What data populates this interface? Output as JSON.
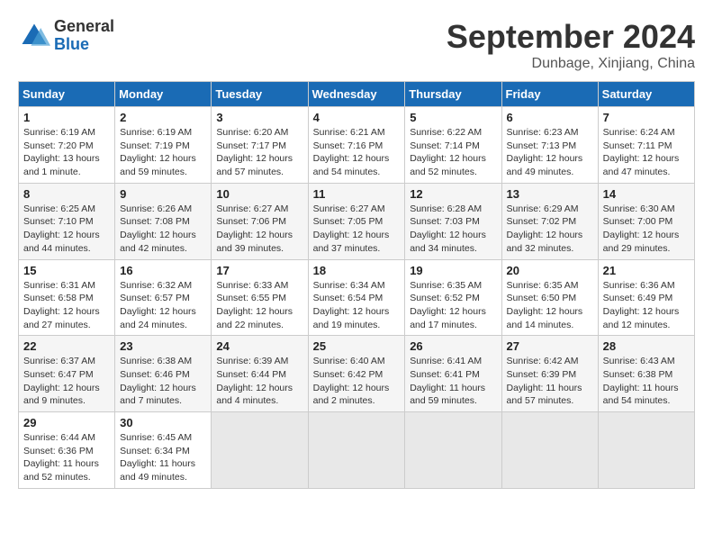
{
  "header": {
    "logo_general": "General",
    "logo_blue": "Blue",
    "month_title": "September 2024",
    "location": "Dunbage, Xinjiang, China"
  },
  "weekdays": [
    "Sunday",
    "Monday",
    "Tuesday",
    "Wednesday",
    "Thursday",
    "Friday",
    "Saturday"
  ],
  "weeks": [
    [
      {
        "day": "1",
        "info": "Sunrise: 6:19 AM\nSunset: 7:20 PM\nDaylight: 13 hours\nand 1 minute."
      },
      {
        "day": "2",
        "info": "Sunrise: 6:19 AM\nSunset: 7:19 PM\nDaylight: 12 hours\nand 59 minutes."
      },
      {
        "day": "3",
        "info": "Sunrise: 6:20 AM\nSunset: 7:17 PM\nDaylight: 12 hours\nand 57 minutes."
      },
      {
        "day": "4",
        "info": "Sunrise: 6:21 AM\nSunset: 7:16 PM\nDaylight: 12 hours\nand 54 minutes."
      },
      {
        "day": "5",
        "info": "Sunrise: 6:22 AM\nSunset: 7:14 PM\nDaylight: 12 hours\nand 52 minutes."
      },
      {
        "day": "6",
        "info": "Sunrise: 6:23 AM\nSunset: 7:13 PM\nDaylight: 12 hours\nand 49 minutes."
      },
      {
        "day": "7",
        "info": "Sunrise: 6:24 AM\nSunset: 7:11 PM\nDaylight: 12 hours\nand 47 minutes."
      }
    ],
    [
      {
        "day": "8",
        "info": "Sunrise: 6:25 AM\nSunset: 7:10 PM\nDaylight: 12 hours\nand 44 minutes."
      },
      {
        "day": "9",
        "info": "Sunrise: 6:26 AM\nSunset: 7:08 PM\nDaylight: 12 hours\nand 42 minutes."
      },
      {
        "day": "10",
        "info": "Sunrise: 6:27 AM\nSunset: 7:06 PM\nDaylight: 12 hours\nand 39 minutes."
      },
      {
        "day": "11",
        "info": "Sunrise: 6:27 AM\nSunset: 7:05 PM\nDaylight: 12 hours\nand 37 minutes."
      },
      {
        "day": "12",
        "info": "Sunrise: 6:28 AM\nSunset: 7:03 PM\nDaylight: 12 hours\nand 34 minutes."
      },
      {
        "day": "13",
        "info": "Sunrise: 6:29 AM\nSunset: 7:02 PM\nDaylight: 12 hours\nand 32 minutes."
      },
      {
        "day": "14",
        "info": "Sunrise: 6:30 AM\nSunset: 7:00 PM\nDaylight: 12 hours\nand 29 minutes."
      }
    ],
    [
      {
        "day": "15",
        "info": "Sunrise: 6:31 AM\nSunset: 6:58 PM\nDaylight: 12 hours\nand 27 minutes."
      },
      {
        "day": "16",
        "info": "Sunrise: 6:32 AM\nSunset: 6:57 PM\nDaylight: 12 hours\nand 24 minutes."
      },
      {
        "day": "17",
        "info": "Sunrise: 6:33 AM\nSunset: 6:55 PM\nDaylight: 12 hours\nand 22 minutes."
      },
      {
        "day": "18",
        "info": "Sunrise: 6:34 AM\nSunset: 6:54 PM\nDaylight: 12 hours\nand 19 minutes."
      },
      {
        "day": "19",
        "info": "Sunrise: 6:35 AM\nSunset: 6:52 PM\nDaylight: 12 hours\nand 17 minutes."
      },
      {
        "day": "20",
        "info": "Sunrise: 6:35 AM\nSunset: 6:50 PM\nDaylight: 12 hours\nand 14 minutes."
      },
      {
        "day": "21",
        "info": "Sunrise: 6:36 AM\nSunset: 6:49 PM\nDaylight: 12 hours\nand 12 minutes."
      }
    ],
    [
      {
        "day": "22",
        "info": "Sunrise: 6:37 AM\nSunset: 6:47 PM\nDaylight: 12 hours\nand 9 minutes."
      },
      {
        "day": "23",
        "info": "Sunrise: 6:38 AM\nSunset: 6:46 PM\nDaylight: 12 hours\nand 7 minutes."
      },
      {
        "day": "24",
        "info": "Sunrise: 6:39 AM\nSunset: 6:44 PM\nDaylight: 12 hours\nand 4 minutes."
      },
      {
        "day": "25",
        "info": "Sunrise: 6:40 AM\nSunset: 6:42 PM\nDaylight: 12 hours\nand 2 minutes."
      },
      {
        "day": "26",
        "info": "Sunrise: 6:41 AM\nSunset: 6:41 PM\nDaylight: 11 hours\nand 59 minutes."
      },
      {
        "day": "27",
        "info": "Sunrise: 6:42 AM\nSunset: 6:39 PM\nDaylight: 11 hours\nand 57 minutes."
      },
      {
        "day": "28",
        "info": "Sunrise: 6:43 AM\nSunset: 6:38 PM\nDaylight: 11 hours\nand 54 minutes."
      }
    ],
    [
      {
        "day": "29",
        "info": "Sunrise: 6:44 AM\nSunset: 6:36 PM\nDaylight: 11 hours\nand 52 minutes."
      },
      {
        "day": "30",
        "info": "Sunrise: 6:45 AM\nSunset: 6:34 PM\nDaylight: 11 hours\nand 49 minutes."
      },
      null,
      null,
      null,
      null,
      null
    ]
  ]
}
